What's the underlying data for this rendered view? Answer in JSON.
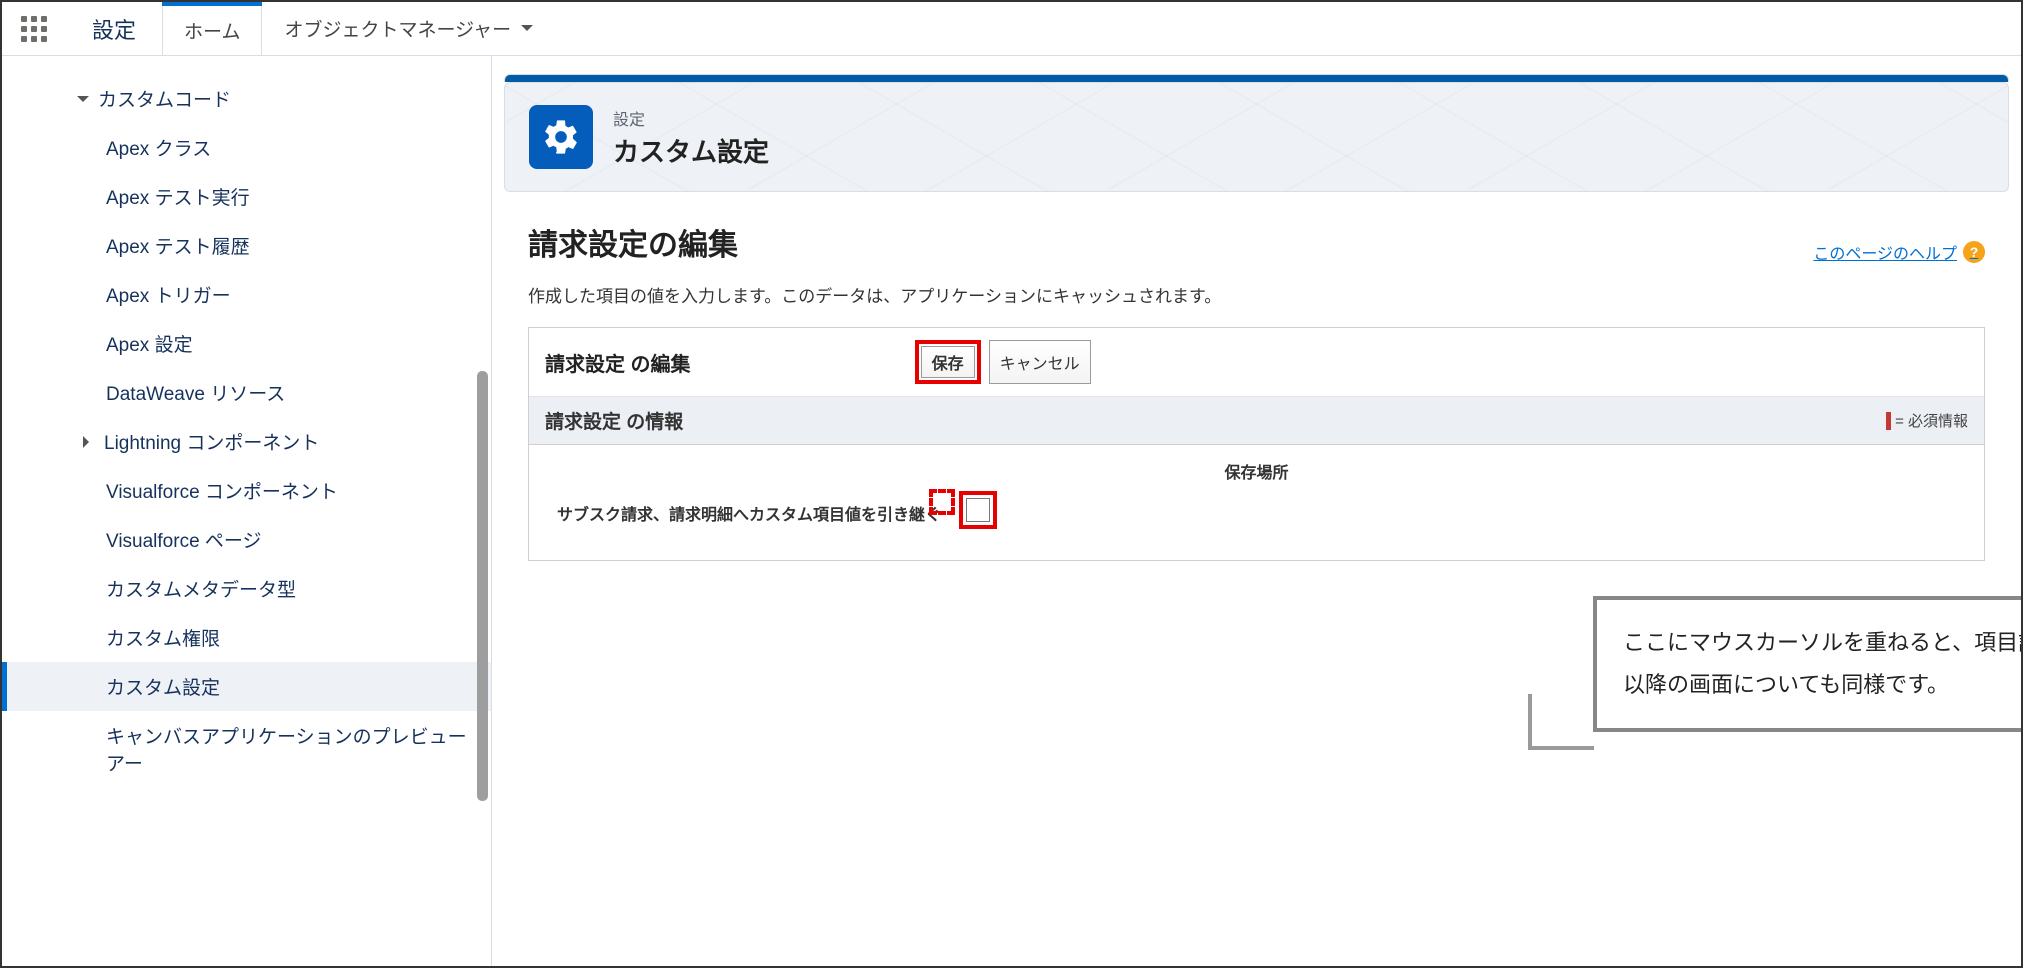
{
  "topbar": {
    "setup_label": "設定",
    "tabs": {
      "home": "ホーム",
      "object_manager": "オブジェクトマネージャー"
    }
  },
  "sidebar": {
    "section_label": "カスタムコード",
    "items": [
      "Apex クラス",
      "Apex テスト実行",
      "Apex テスト履歴",
      "Apex トリガー",
      "Apex 設定",
      "DataWeave リソース",
      "Lightning コンポーネント",
      "Visualforce コンポーネント",
      "Visualforce ページ",
      "カスタムメタデータ型",
      "カスタム権限",
      "カスタム設定",
      "キャンバスアプリケーションのプレビューアー"
    ]
  },
  "header": {
    "breadcrumb": "設定",
    "title": "カスタム設定"
  },
  "page": {
    "title": "請求設定の編集",
    "help_link": "このページのヘルプ",
    "description": "作成した項目の値を入力します。このデータは、アプリケーションにキャッシュされます。"
  },
  "form": {
    "edit_title": "請求設定 の編集",
    "save_btn": "保存",
    "cancel_btn": "キャンセル",
    "info_title": "請求設定 の情報",
    "required_legend": "= 必須情報",
    "field_header": "保存場所",
    "field_label": "サブスク請求、請求明細へカスタム項目値を引き継ぐ"
  },
  "callout": {
    "line1": "ここにマウスカーソルを重ねると、項目説明が表示されます。",
    "line2": "以降の画面についても同様です。"
  }
}
